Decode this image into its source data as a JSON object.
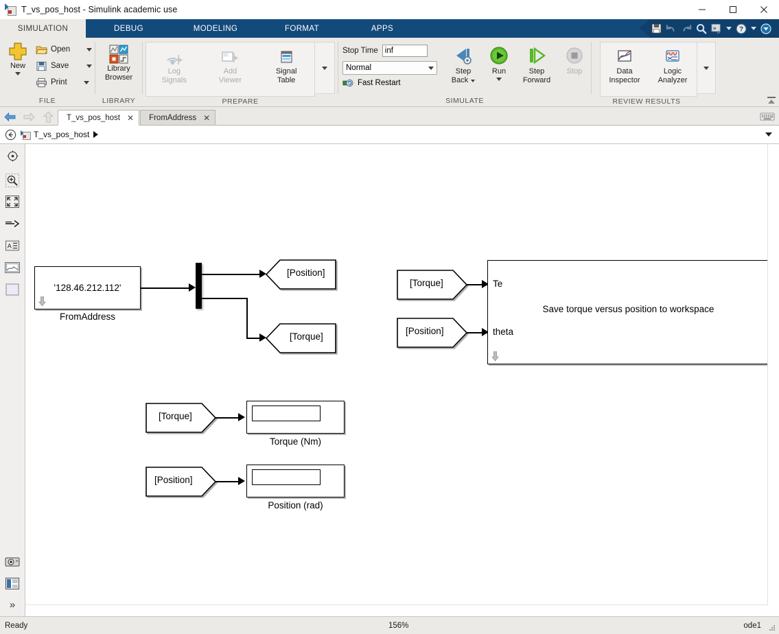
{
  "window": {
    "title": "T_vs_pos_host - Simulink academic use",
    "app_icon": "simulink-model-icon",
    "controls": [
      {
        "name": "minimize",
        "glyph": "minimize-icon"
      },
      {
        "name": "maximize",
        "glyph": "maximize-icon"
      },
      {
        "name": "close",
        "glyph": "close-icon"
      }
    ]
  },
  "ribbon": {
    "tabs": [
      {
        "label": "SIMULATION",
        "active": true
      },
      {
        "label": "DEBUG",
        "active": false
      },
      {
        "label": "MODELING",
        "active": false
      },
      {
        "label": "FORMAT",
        "active": false
      },
      {
        "label": "APPS",
        "active": false
      }
    ],
    "quick_access": [
      {
        "name": "save-icon"
      },
      {
        "name": "undo-icon"
      },
      {
        "name": "redo-icon"
      },
      {
        "name": "search-icon"
      },
      {
        "name": "shortcuts-icon"
      },
      {
        "name": "help-icon"
      },
      {
        "name": "minimize-ribbon-icon"
      }
    ],
    "groups": [
      {
        "label": "FILE",
        "items": [
          {
            "label": "New",
            "icon": "new-plus-icon",
            "type": "big-split"
          },
          {
            "label": "Open",
            "icon": "open-folder-icon",
            "type": "small-split"
          },
          {
            "label": "Save",
            "icon": "save-disk-icon",
            "type": "small-split"
          },
          {
            "label": "Print",
            "icon": "printer-icon",
            "type": "small-split"
          }
        ]
      },
      {
        "label": "LIBRARY",
        "items": [
          {
            "label": "Library\nBrowser",
            "label_line1": "Library",
            "label_line2": "Browser",
            "icon": "library-browser-icon",
            "type": "big"
          }
        ]
      },
      {
        "label": "PREPARE",
        "items": [
          {
            "label_line1": "Log",
            "label_line2": "Signals",
            "icon": "log-signals-icon",
            "type": "big",
            "disabled": true
          },
          {
            "label_line1": "Add",
            "label_line2": "Viewer",
            "icon": "add-viewer-icon",
            "type": "big",
            "disabled": true
          },
          {
            "label_line1": "Signal",
            "label_line2": "Table",
            "icon": "signal-table-icon",
            "type": "big",
            "disabled": false
          }
        ]
      },
      {
        "label": "SIMULATE",
        "stop_time_label": "Stop Time",
        "stop_time_value": "inf",
        "sim_mode_value": "Normal",
        "fast_restart_label": "Fast Restart",
        "items": [
          {
            "label_line1": "Step",
            "label_line2": "Back",
            "icon": "step-back-icon",
            "type": "big-split",
            "disabled": false
          },
          {
            "label_line1": "Run",
            "label_line2": "",
            "icon": "run-icon",
            "type": "big-split"
          },
          {
            "label_line1": "Step",
            "label_line2": "Forward",
            "icon": "step-forward-icon",
            "type": "big"
          },
          {
            "label_line1": "Stop",
            "label_line2": "",
            "icon": "stop-icon",
            "type": "big",
            "disabled": true
          }
        ]
      },
      {
        "label": "REVIEW RESULTS",
        "items": [
          {
            "label_line1": "Data",
            "label_line2": "Inspector",
            "icon": "data-inspector-icon",
            "type": "big"
          },
          {
            "label_line1": "Logic",
            "label_line2": "Analyzer",
            "icon": "logic-analyzer-icon",
            "type": "big"
          }
        ]
      }
    ]
  },
  "model_tabs": {
    "nav": [
      "back-arrow-icon",
      "forward-arrow-icon",
      "up-arrow-icon"
    ],
    "tabs": [
      {
        "label": "T_vs_pos_host",
        "active": true,
        "closable": true
      },
      {
        "label": "FromAddress",
        "active": false,
        "closable": true
      }
    ],
    "keyboard_icon": "keyboard-icon"
  },
  "breadcrumb": {
    "back_icon": "back-circle-icon",
    "path": "T_vs_pos_host",
    "dropdown_icon": "chevron-down-icon"
  },
  "left_toolbar": {
    "items": [
      {
        "name": "target-icon"
      },
      {
        "name": "zoom-in-icon"
      },
      {
        "name": "fit-to-view-icon"
      },
      {
        "name": "signal-line-icon"
      },
      {
        "name": "annotation-icon"
      },
      {
        "name": "image-icon"
      },
      {
        "name": "area-icon"
      }
    ],
    "bottom_items": [
      {
        "name": "camera-icon"
      },
      {
        "name": "layout-icon"
      },
      {
        "name": "expand-icon"
      }
    ]
  },
  "diagram": {
    "blocks": [
      {
        "id": "fromaddress",
        "type": "subsystem",
        "text": "'128.46.212.112'",
        "label": "FromAddress",
        "has_drilldown": true
      },
      {
        "id": "demux",
        "type": "demux"
      },
      {
        "id": "goto-position",
        "type": "goto",
        "text": "[Position]"
      },
      {
        "id": "goto-torque",
        "type": "goto",
        "text": "[Torque]"
      },
      {
        "id": "from-torque-1",
        "type": "from",
        "text": "[Torque]"
      },
      {
        "id": "from-position-1",
        "type": "from",
        "text": "[Position]"
      },
      {
        "id": "save-subsystem",
        "type": "subsystem",
        "text": "Save torque versus position to workspace",
        "port_labels": [
          "Te",
          "theta"
        ],
        "has_drilldown": true
      },
      {
        "id": "from-torque-2",
        "type": "from",
        "text": "[Torque]"
      },
      {
        "id": "display-torque",
        "type": "display",
        "label": "Torque (Nm)"
      },
      {
        "id": "from-position-2",
        "type": "from",
        "text": "[Position]"
      },
      {
        "id": "display-position",
        "type": "display",
        "label": "Position (rad)"
      }
    ]
  },
  "status_bar": {
    "state": "Ready",
    "zoom": "156%",
    "solver": "ode1"
  },
  "colors": {
    "ribbon_blue": "#134a7c",
    "ribbon_face": "#eceae6",
    "accent_green": "#4caf28",
    "canvas": "#ffffff"
  }
}
